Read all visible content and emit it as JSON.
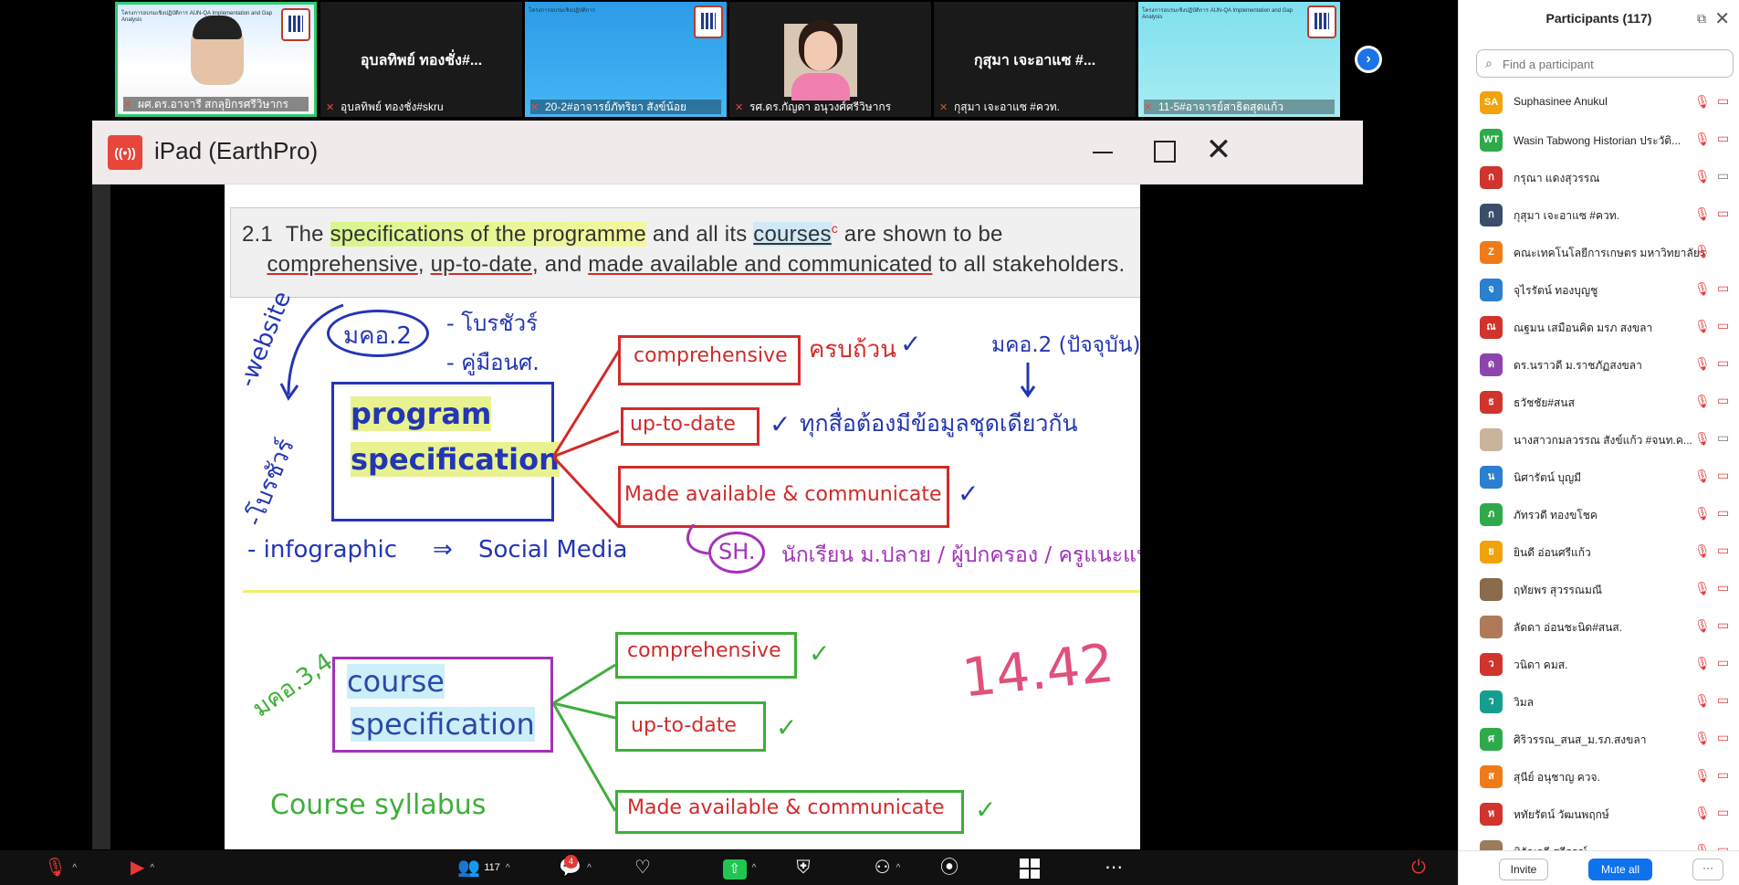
{
  "video_strip": {
    "tiles": [
      {
        "name": "ผศ.ดร.อาจารี สกลุยิกรศรีวิษากร",
        "overlay": "ยากร",
        "banner": "โครงการอบรมเชิงปฏิบัติการ AUN-QA Implementation and Gap Analysis",
        "date": "วันที่ 8 และ 25 เมษายน 2568"
      },
      {
        "name": "อุบลทิพย์ ทองชั่ง#skru",
        "display": "อุบลทิพย์ ทองชั่ง#..."
      },
      {
        "name": "20-2#อาจารย์ภัทริยา สังข์น้อย",
        "banner": "โครงการอบรมเชิงปฏิบัติการ",
        "date": "วันที่ 18 - 20 เมษายน 2568",
        "brand": "SKRU"
      },
      {
        "name": "รศ.ดร.กัญดา อนุวงศ์ศรีวิษากร"
      },
      {
        "name": "กุสุมา เจะอาแซ #ควท.",
        "display": "กุสุมา เจะอาแซ #..."
      },
      {
        "name": "11-5#อาจารย์สาธิตสุดแก้ว",
        "banner": "โครงการอบรมเชิงปฏิบัติการ AUN-QA Implementation and Gap Analysis",
        "date": "วันที่ 8 และ 25 เมษายน 2568"
      }
    ],
    "next_icon": "chevron-right-icon"
  },
  "share_window": {
    "title": "iPad (EarthPro)",
    "close_glyph": "✕"
  },
  "slide": {
    "section": "2.1",
    "text_parts": [
      "The",
      "specifications of the programme",
      "and all its",
      "courses",
      "c",
      "are shown to be",
      "comprehensive",
      "up-to-date",
      "and",
      "made available and communicated",
      "to all stakeholders."
    ],
    "notes": {
      "website": "-website",
      "brochure": "-โบรชัวร์",
      "mko2": "มคอ.2",
      "brochure2": "- โบรชัวร์",
      "handbook": "- คู่มือนศ.",
      "complete": "ครบถ้วน",
      "mko2_current": "มคอ.2 (ปัจจุบัน)",
      "same_data": "ทุกสื่อต้องมีข้อมูลชุดเดียวกัน",
      "infographic": "- infographic",
      "arrow": "⇒",
      "social": "Social Media",
      "sh": "SH.",
      "stakeholders": "นักเรียน ม.ปลาย / ผู้ปกครอง / ครูแนะแนว",
      "mko34": "มคอ.3,4",
      "time": "14.42",
      "course_syllabus": "Course syllabus"
    },
    "program": {
      "title_line1": "program",
      "title_line2": "specification",
      "items": [
        "comprehensive",
        "up-to-date",
        "Made available & communicate"
      ]
    },
    "course": {
      "title_line1": "course",
      "title_line2": "specification",
      "items": [
        "comprehensive",
        "up-to-date",
        "Made available & communicate"
      ]
    },
    "check": "✓"
  },
  "participants": {
    "title": "Participants (117)",
    "search_placeholder": "Find a participant",
    "list": [
      {
        "initials": "SA",
        "color": "#f0a30a",
        "name": "Suphasinee Anukul",
        "cam": "off"
      },
      {
        "initials": "WT",
        "color": "#2eaa4a",
        "name": "Wasin Tabwong Historian ประวัติ...",
        "cam": "off"
      },
      {
        "initials": "ก",
        "color": "#d0342c",
        "name": "กรุณา แดงสุวรรณ",
        "cam": "on"
      },
      {
        "initials": "ก",
        "color": "#3a4e6b",
        "name": "กุสุมา เจะอาแซ #ควท.",
        "cam": "off"
      },
      {
        "initials": "Z",
        "color": "#f07b16",
        "name": "คณะเทคโนโลยีการเกษตร มหาวิทยาลัยราช...",
        "cam": "none"
      },
      {
        "initials": "จ",
        "color": "#2b7fd1",
        "name": "จุไรรัตน์ ทองบุญชู",
        "cam": "off"
      },
      {
        "initials": "ณ",
        "color": "#d0342c",
        "name": "ณฐมน เสมือนคิด มรภ สงขลา",
        "cam": "off"
      },
      {
        "initials": "ด",
        "color": "#8e44ad",
        "name": "ดร.นราวดี ม.ราชภัฏสงขลา",
        "cam": "off"
      },
      {
        "initials": "ธ",
        "color": "#d0342c",
        "name": "ธวัชชัย#สนส",
        "cam": "off"
      },
      {
        "initials": "",
        "color": "#c9b39a",
        "name": "นางสาวกมลวรรณ สังข์แก้ว #จนท.ค...",
        "cam": "on"
      },
      {
        "initials": "น",
        "color": "#2b7fd1",
        "name": "นิศารัตน์ บุญมี",
        "cam": "off"
      },
      {
        "initials": "ภ",
        "color": "#2eaa4a",
        "name": "ภัทรวดี ทองขโชค",
        "cam": "off"
      },
      {
        "initials": "ย",
        "color": "#f0a30a",
        "name": "ยินดี อ่อนศรีแก้ว",
        "cam": "off"
      },
      {
        "initials": "",
        "color": "#8a6b4c",
        "name": "ฤทัยพร สุวรรณมณี",
        "cam": "off"
      },
      {
        "initials": "",
        "color": "#b07a5a",
        "name": "ลัดดา อ่อนชะนิด#สนส.",
        "cam": "off"
      },
      {
        "initials": "ว",
        "color": "#d0342c",
        "name": "วนิดา คมส.",
        "cam": "off"
      },
      {
        "initials": "ว",
        "color": "#159e8f",
        "name": "วิมล",
        "cam": "off"
      },
      {
        "initials": "ศ",
        "color": "#2eaa4a",
        "name": "ศิริวรรณ_สนส_ม.รภ.สงขลา",
        "cam": "off"
      },
      {
        "initials": "ส",
        "color": "#f07b16",
        "name": "สุนีย์ อนุชาญ ควจ.",
        "cam": "off"
      },
      {
        "initials": "ห",
        "color": "#d0342c",
        "name": "หทัยรัตน์ วัฒนพฤกษ์",
        "cam": "off"
      },
      {
        "initials": "",
        "color": "#9a7b5c",
        "name": "หิรัณรดี สวีรรณ์",
        "cam": "off"
      }
    ],
    "invite": "Invite",
    "mute_all": "Mute all",
    "more": "···"
  },
  "toolbar": {
    "participants_count": "117",
    "chat_badge": "4"
  },
  "colors": {
    "red": "#d12b2b",
    "blue": "#2336b3",
    "green": "#3fae3a",
    "purple": "#a233b8",
    "zoom_blue": "#0e72ed"
  }
}
